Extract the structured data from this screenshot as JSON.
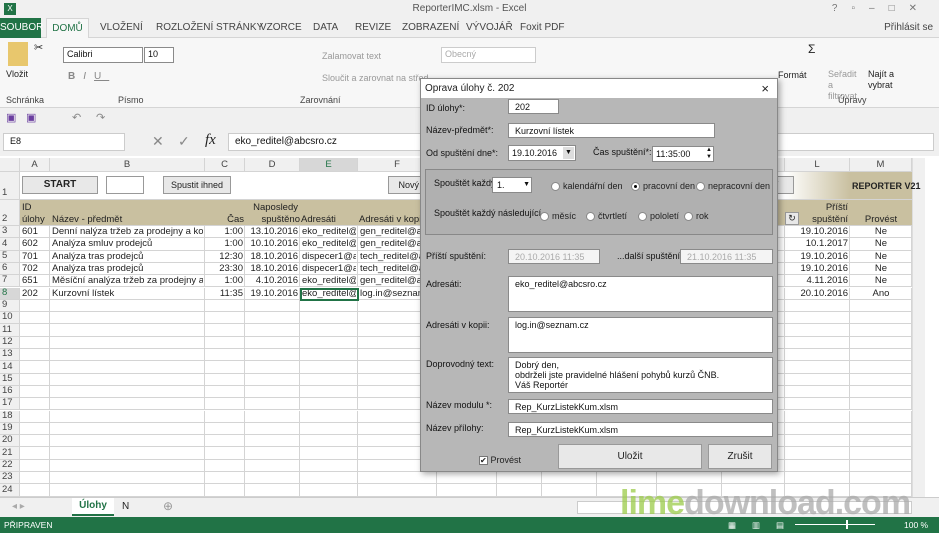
{
  "app": {
    "title": "ReporterIMC.xlsm - Excel",
    "signin": "Přihlásit se"
  },
  "ribbon_tabs": [
    "SOUBOR",
    "DOMŮ",
    "VLOŽENÍ",
    "ROZLOŽENÍ STRÁNKY",
    "VZORCE",
    "DATA",
    "REVIZE",
    "ZOBRAZENÍ",
    "VÝVOJÁŘ",
    "Foxit PDF"
  ],
  "ribbon": {
    "paste": "Vložit",
    "clipboard": "Schránka",
    "font_name": "Calibri",
    "font_size": "10",
    "font_group": "Písmo",
    "wrap": "Zalamovat text",
    "merge": "Sloučit a zarovnat na střed",
    "align_group": "Zarovnání",
    "number_format": "Obecný",
    "format": "Formát",
    "sort": "Seřadit a filtrovat",
    "find": "Najít a vybrat",
    "edit_group": "Úpravy"
  },
  "formula": {
    "namebox": "E8",
    "fx": "fx",
    "value": "eko_reditel@abcsro.cz"
  },
  "columns": [
    "A",
    "B",
    "C",
    "D",
    "E",
    "F",
    "L",
    "M"
  ],
  "sheet": {
    "start": "START",
    "run_now": "Spustit ihned",
    "new": "Nový",
    "new_right": "ní",
    "reporter": "REPORTER V21",
    "headers": {
      "id_top": "ID",
      "id": "úlohy",
      "name": "Název - předmět",
      "time": "Čas",
      "last_top": "Naposledy",
      "last": "spuštěno",
      "to": "Adresáti",
      "cc": "Adresáti v kopii",
      "next_top": "Příští",
      "next": "spuštění",
      "run": "Provést"
    },
    "rows": [
      [
        "601",
        "Denní nalýza tržeb za prodejny a komod",
        "1:00",
        "13.10.2016",
        "eko_reditel@a",
        "gen_reditel@ab",
        "19.10.2016",
        "Ne"
      ],
      [
        "602",
        "Analýza smluv prodejců",
        "1:00",
        "10.10.2016",
        "eko_reditel@a",
        "gen_reditel@ab",
        "10.1.2017",
        "Ne"
      ],
      [
        "701",
        "Analýza tras prodejců",
        "12:30",
        "18.10.2016",
        "dispecer1@abc",
        "tech_reditel@a",
        "19.10.2016",
        "Ne"
      ],
      [
        "702",
        "Analýza tras prodejců",
        "23:30",
        "18.10.2016",
        "dispecer1@abc",
        "tech_reditel@a",
        "19.10.2016",
        "Ne"
      ],
      [
        "651",
        "Měsíční analýza tržeb za prodejny a kom",
        "1:00",
        "4.10.2016",
        "eko_reditel@a",
        "gen_reditel@ab",
        "4.11.2016",
        "Ne"
      ],
      [
        "202",
        "Kurzovní lístek",
        "11:35",
        "19.10.2016",
        "eko_reditel@a",
        "log.in@seznam",
        "20.10.2016",
        "Ano"
      ]
    ]
  },
  "dialog": {
    "title": "Oprava úlohy č. 202",
    "close": "×",
    "id_label": "ID úlohy*:",
    "id": "202",
    "name_label": "Název-předmět*:",
    "name": "Kurzovní lístek",
    "from_label": "Od spuštění dne*:",
    "from": "19.10.2016",
    "time_label": "Čas spuštění*:",
    "time": "11:35:00",
    "every_label": "Spouštět každý",
    "every": "1.",
    "day_opts": [
      "kalendářní den",
      "pracovní den",
      "nepracovní den"
    ],
    "day_selected": "pracovní den",
    "next_label": "Spouštět každý následující",
    "period_opts": [
      "měsíc",
      "čtvrtletí",
      "pololetí",
      "rok"
    ],
    "next_run_label": "Příští spuštění:",
    "next_run": "20.10.2016 11:35",
    "after_label": "...další spuštění:",
    "after": "21.10.2016 11:35",
    "to_label": "Adresáti:",
    "to": "eko_reditel@abcsro.cz",
    "cc_label": "Adresáti v kopii:",
    "cc": "log.in@seznam.cz",
    "text_label": "Doprovodný text:",
    "text": "Dobrý den,\nobdrželi jste pravidelné hlášení pohybů kurzů ČNB.\nVáš Reportér",
    "module_label": "Název modulu *:",
    "module": "Rep_KurzListekKum.xlsm",
    "attach_label": "Název přílohy:",
    "attach": "Rep_KurzListekKum.xlsm",
    "run_label": "Provést",
    "run_checked": true,
    "save": "Uložit",
    "cancel": "Zrušit"
  },
  "sheet_tabs": [
    "Úlohy",
    "N"
  ],
  "status": {
    "ready": "PŘIPRAVEN",
    "zoom": "100 %"
  },
  "watermark": "limedownload.com",
  "colors": {
    "excel_green": "#217346",
    "header_band": "#c9c0a0"
  }
}
